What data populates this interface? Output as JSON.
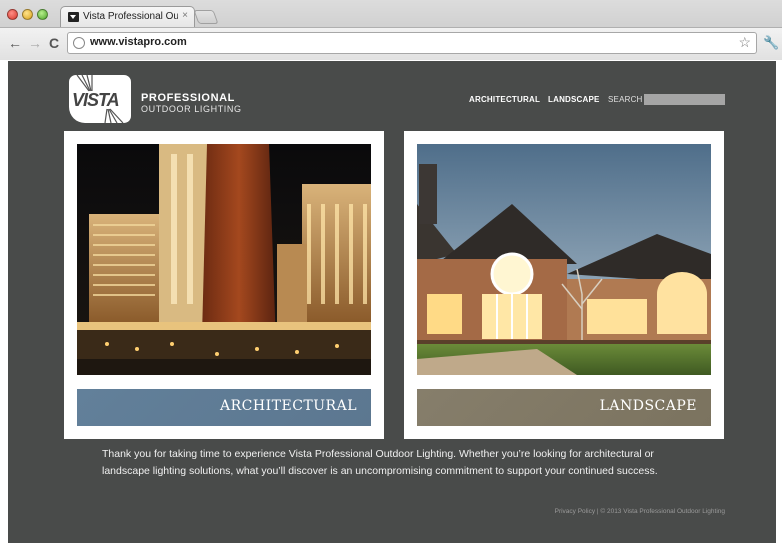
{
  "browser": {
    "tab_title": "Vista Professional Outdoor L",
    "tab_close": "×",
    "url": "www.vistapro.com",
    "icons": {
      "back": "arrow-left",
      "forward": "arrow-right",
      "reload": "reload",
      "star": "star",
      "wrench": "wrench"
    }
  },
  "header": {
    "logo_text": "VISTA",
    "brand_line1": "PROFESSIONAL",
    "brand_line2": "OUTDOOR LIGHTING",
    "nav": {
      "architectural": "ARCHITECTURAL",
      "landscape": "LANDSCAPE",
      "search": "SEARCH"
    }
  },
  "panels": {
    "architectural": {
      "label": "ARCHITECTURAL"
    },
    "landscape": {
      "label": "LANDSCAPE"
    }
  },
  "intro_text": "Thank you for taking time to experience Vista Professional Outdoor Lighting. Whether you’re looking for architectural or landscape lighting solutions, what you’ll discover is an uncompromising commitment to support your continued success.",
  "footer": {
    "text": "Privacy Policy | © 2013 Vista Professional Outdoor Lighting"
  },
  "colors": {
    "site_bg": "#494b4a",
    "architectural_label": "#5f7b94",
    "landscape_label": "#817965"
  }
}
